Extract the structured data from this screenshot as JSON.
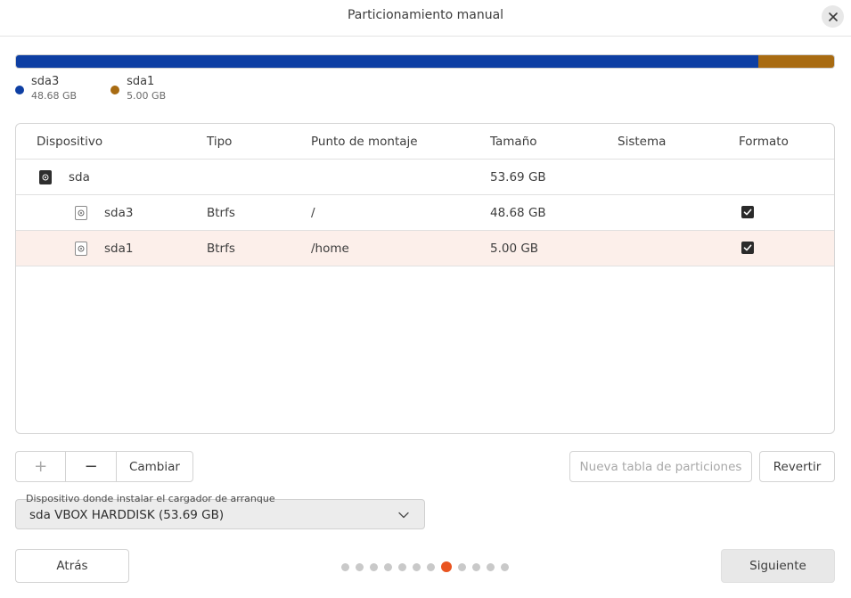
{
  "window": {
    "title": "Particionamiento manual"
  },
  "usage": {
    "segments": [
      {
        "name": "sda3",
        "size": "48.68 GB",
        "color": "#0e3fa3",
        "fraction": 0.907
      },
      {
        "name": "sda1",
        "size": "5.00 GB",
        "color": "#a86b12",
        "fraction": 0.093
      }
    ]
  },
  "table": {
    "headers": [
      "Dispositivo",
      "Tipo",
      "Punto de montaje",
      "Tamaño",
      "Sistema",
      "Formato"
    ],
    "rows": [
      {
        "device": "sda",
        "type": "",
        "mount": "",
        "size": "53.69 GB",
        "system": "",
        "format": null,
        "level": 0,
        "icon": "disk-icon"
      },
      {
        "device": "sda3",
        "type": "Btrfs",
        "mount": "/",
        "size": "48.68 GB",
        "system": "",
        "format": true,
        "level": 1,
        "icon": "partition-icon"
      },
      {
        "device": "sda1",
        "type": "Btrfs",
        "mount": "/home",
        "size": "5.00 GB",
        "system": "",
        "format": true,
        "level": 1,
        "icon": "partition-icon",
        "selected": true
      }
    ]
  },
  "actions": {
    "add": "+",
    "remove": "−",
    "change": "Cambiar",
    "new_table": "Nueva tabla de particiones",
    "revert": "Revertir"
  },
  "bootloader": {
    "label": "Dispositivo donde instalar el cargador de arranque",
    "value": "sda VBOX HARDDISK (53.69 GB)"
  },
  "nav": {
    "back": "Atrás",
    "next": "Siguiente",
    "steps_total": 12,
    "current_step": 8
  },
  "colors": {
    "accent": "#e95420",
    "selected_row": "#fcefea"
  }
}
